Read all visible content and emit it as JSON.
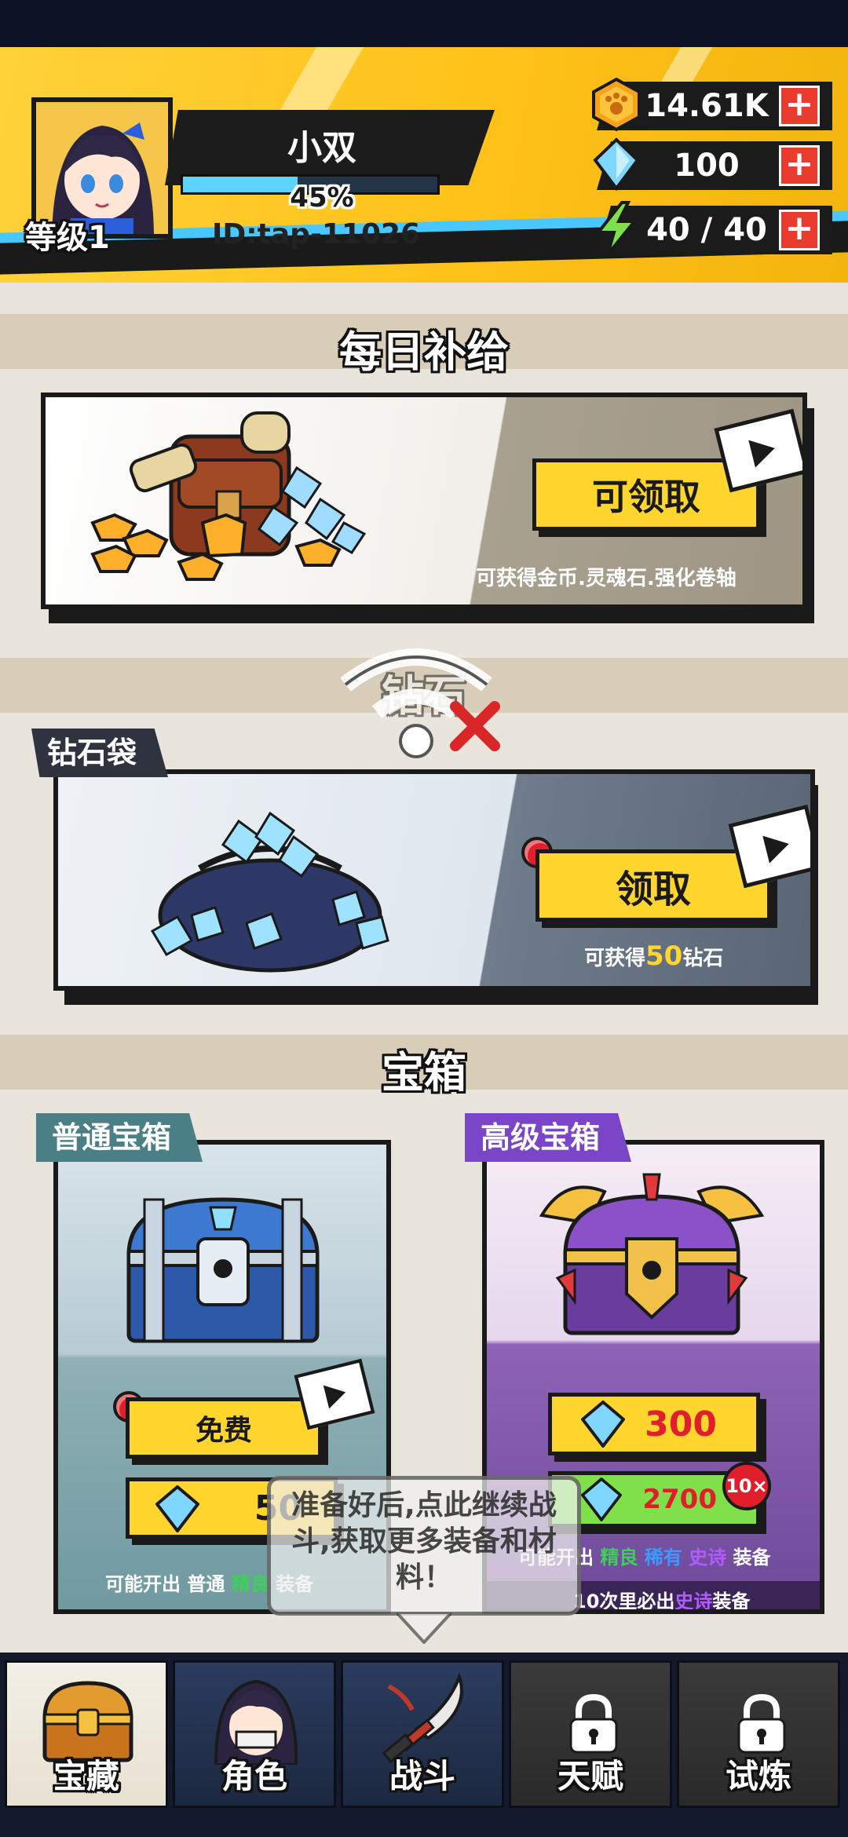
{
  "player": {
    "name": "小双",
    "level_label": "等级1",
    "exp_percent_text": "45%",
    "exp_fraction": 0.45,
    "id_text": "ID:tap-11026"
  },
  "resources": {
    "gold": "14.61K",
    "diamond": "100",
    "energy": "40 / 40",
    "plus_symbol": "+"
  },
  "daily_supply": {
    "title": "每日补给",
    "button_label": "可领取",
    "note": "可获得金币.灵魂石.强化卷轴"
  },
  "diamond_section": {
    "title": "钻石",
    "bag_tag": "钻石袋",
    "button_label": "领取",
    "note_prefix": "可获得",
    "note_amount": "50",
    "note_suffix": "钻石"
  },
  "chest_section": {
    "title": "宝箱",
    "normal": {
      "tag": "普通宝箱",
      "free_label": "免费",
      "cost": "50",
      "note_prefix": "可能开出",
      "note_common": "普通",
      "note_good": "精良",
      "note_suffix": "装备"
    },
    "advanced": {
      "tag": "高级宝箱",
      "cost_single": "300",
      "cost_ten": "2700",
      "ten_badge": "10×",
      "note_prefix": "可能开出",
      "note_good": "精良",
      "note_rare": "稀有",
      "note_epic": "史诗",
      "note_suffix": "装备",
      "guarantee_prefix": "10次里必出",
      "guarantee_epic": "史诗",
      "guarantee_suffix": "装备"
    }
  },
  "tooltip": {
    "text": "准备好后,点此继续战斗,获取更多装备和材料！"
  },
  "nav": {
    "tabs": [
      {
        "label": "宝藏",
        "state": "active"
      },
      {
        "label": "角色",
        "state": "unlocked"
      },
      {
        "label": "战斗",
        "state": "unlocked"
      },
      {
        "label": "天赋",
        "state": "locked"
      },
      {
        "label": "试炼",
        "state": "locked"
      }
    ]
  },
  "colors": {
    "accent_yellow": "#ffd52e",
    "header_cyan": "#48c8ff",
    "badge_red": "#e11e2b",
    "good_green": "#3ecf5a",
    "rare_blue": "#3a9bff",
    "epic_purple": "#b05cff"
  }
}
